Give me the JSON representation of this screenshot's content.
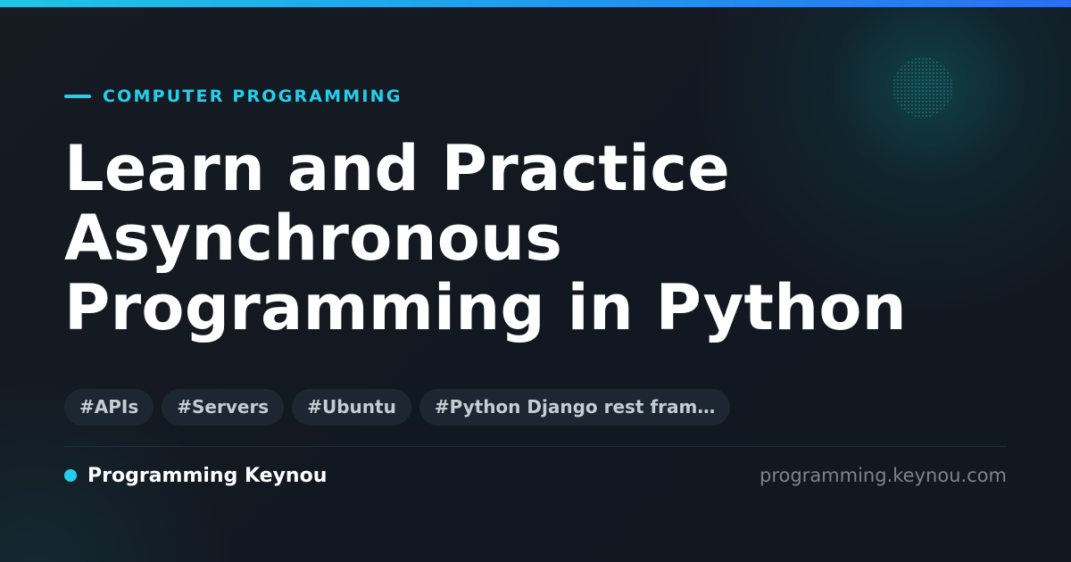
{
  "category": "COMPUTER PROGRAMMING",
  "title": {
    "line1": "Learn and Practice",
    "line2": "Asynchronous",
    "line3": "Programming in Python"
  },
  "tags": [
    "#APIs",
    "#Servers",
    "#Ubuntu",
    "#Python Django rest fram…"
  ],
  "brand": {
    "name": "Programming Keynou",
    "url": "programming.keynou.com"
  },
  "colors": {
    "accent": "#22d0ee",
    "background": "#121821",
    "tag_background": "#1d2731"
  },
  "icons": {
    "category_marker": "dash-line-icon",
    "brand_marker": "dot-icon",
    "decoration": "dot-pattern"
  }
}
